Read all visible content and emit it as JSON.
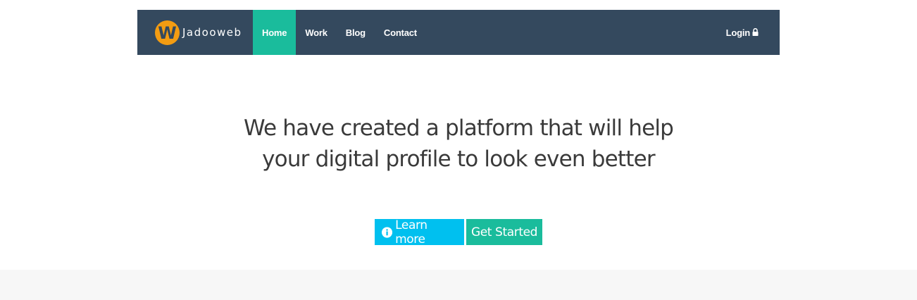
{
  "brand": {
    "logo_letter": "W",
    "name": "Jadooweb"
  },
  "nav": {
    "items": [
      {
        "label": "Home",
        "active": true
      },
      {
        "label": "Work",
        "active": false
      },
      {
        "label": "Blog",
        "active": false
      },
      {
        "label": "Contact",
        "active": false
      }
    ],
    "login_label": "Login",
    "login_icon": "lock-icon"
  },
  "hero": {
    "line1": "We have created a platform that will help",
    "line2": "your digital profile to look even better"
  },
  "buttons": {
    "learn_more_label": "Learn more",
    "learn_more_icon": "info-circle-icon",
    "get_started_label": "Get Started"
  },
  "colors": {
    "navbar": "#34495e",
    "accent": "#1abc9c",
    "info": "#00c0ef",
    "logo": "#f39c12",
    "footer_band": "#f7f7f7"
  }
}
